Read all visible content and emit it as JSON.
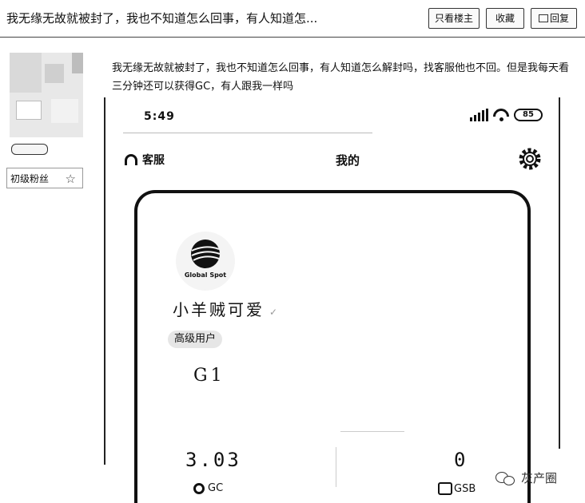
{
  "header": {
    "title": "我无缘无故就被封了，我也不知道怎么回事，有人知道怎...",
    "only_op_label": "只看楼主",
    "favorite_label": "收藏",
    "reply_label": "回复"
  },
  "user": {
    "rank": "初级粉丝",
    "rank_badge": "1"
  },
  "post": {
    "text": "我无缘无故就被封了，我也不知道怎么回事，有人知道怎么解封吗，找客服他也不回。但是我每天看三分钟还可以获得GC，有人跟我一样吗"
  },
  "phone": {
    "status_time": "5:49",
    "battery": "85",
    "service_label": "客服",
    "page_title": "我的",
    "logo_text": "Global Spot",
    "username": "小羊贼可爱",
    "user_level": "高级用户",
    "grade": "G1",
    "gc_value": "3.03",
    "gc_label": "GC",
    "gsb_value": "0",
    "gsb_label": "GSB"
  },
  "watermark": {
    "text": "灰产圈"
  }
}
